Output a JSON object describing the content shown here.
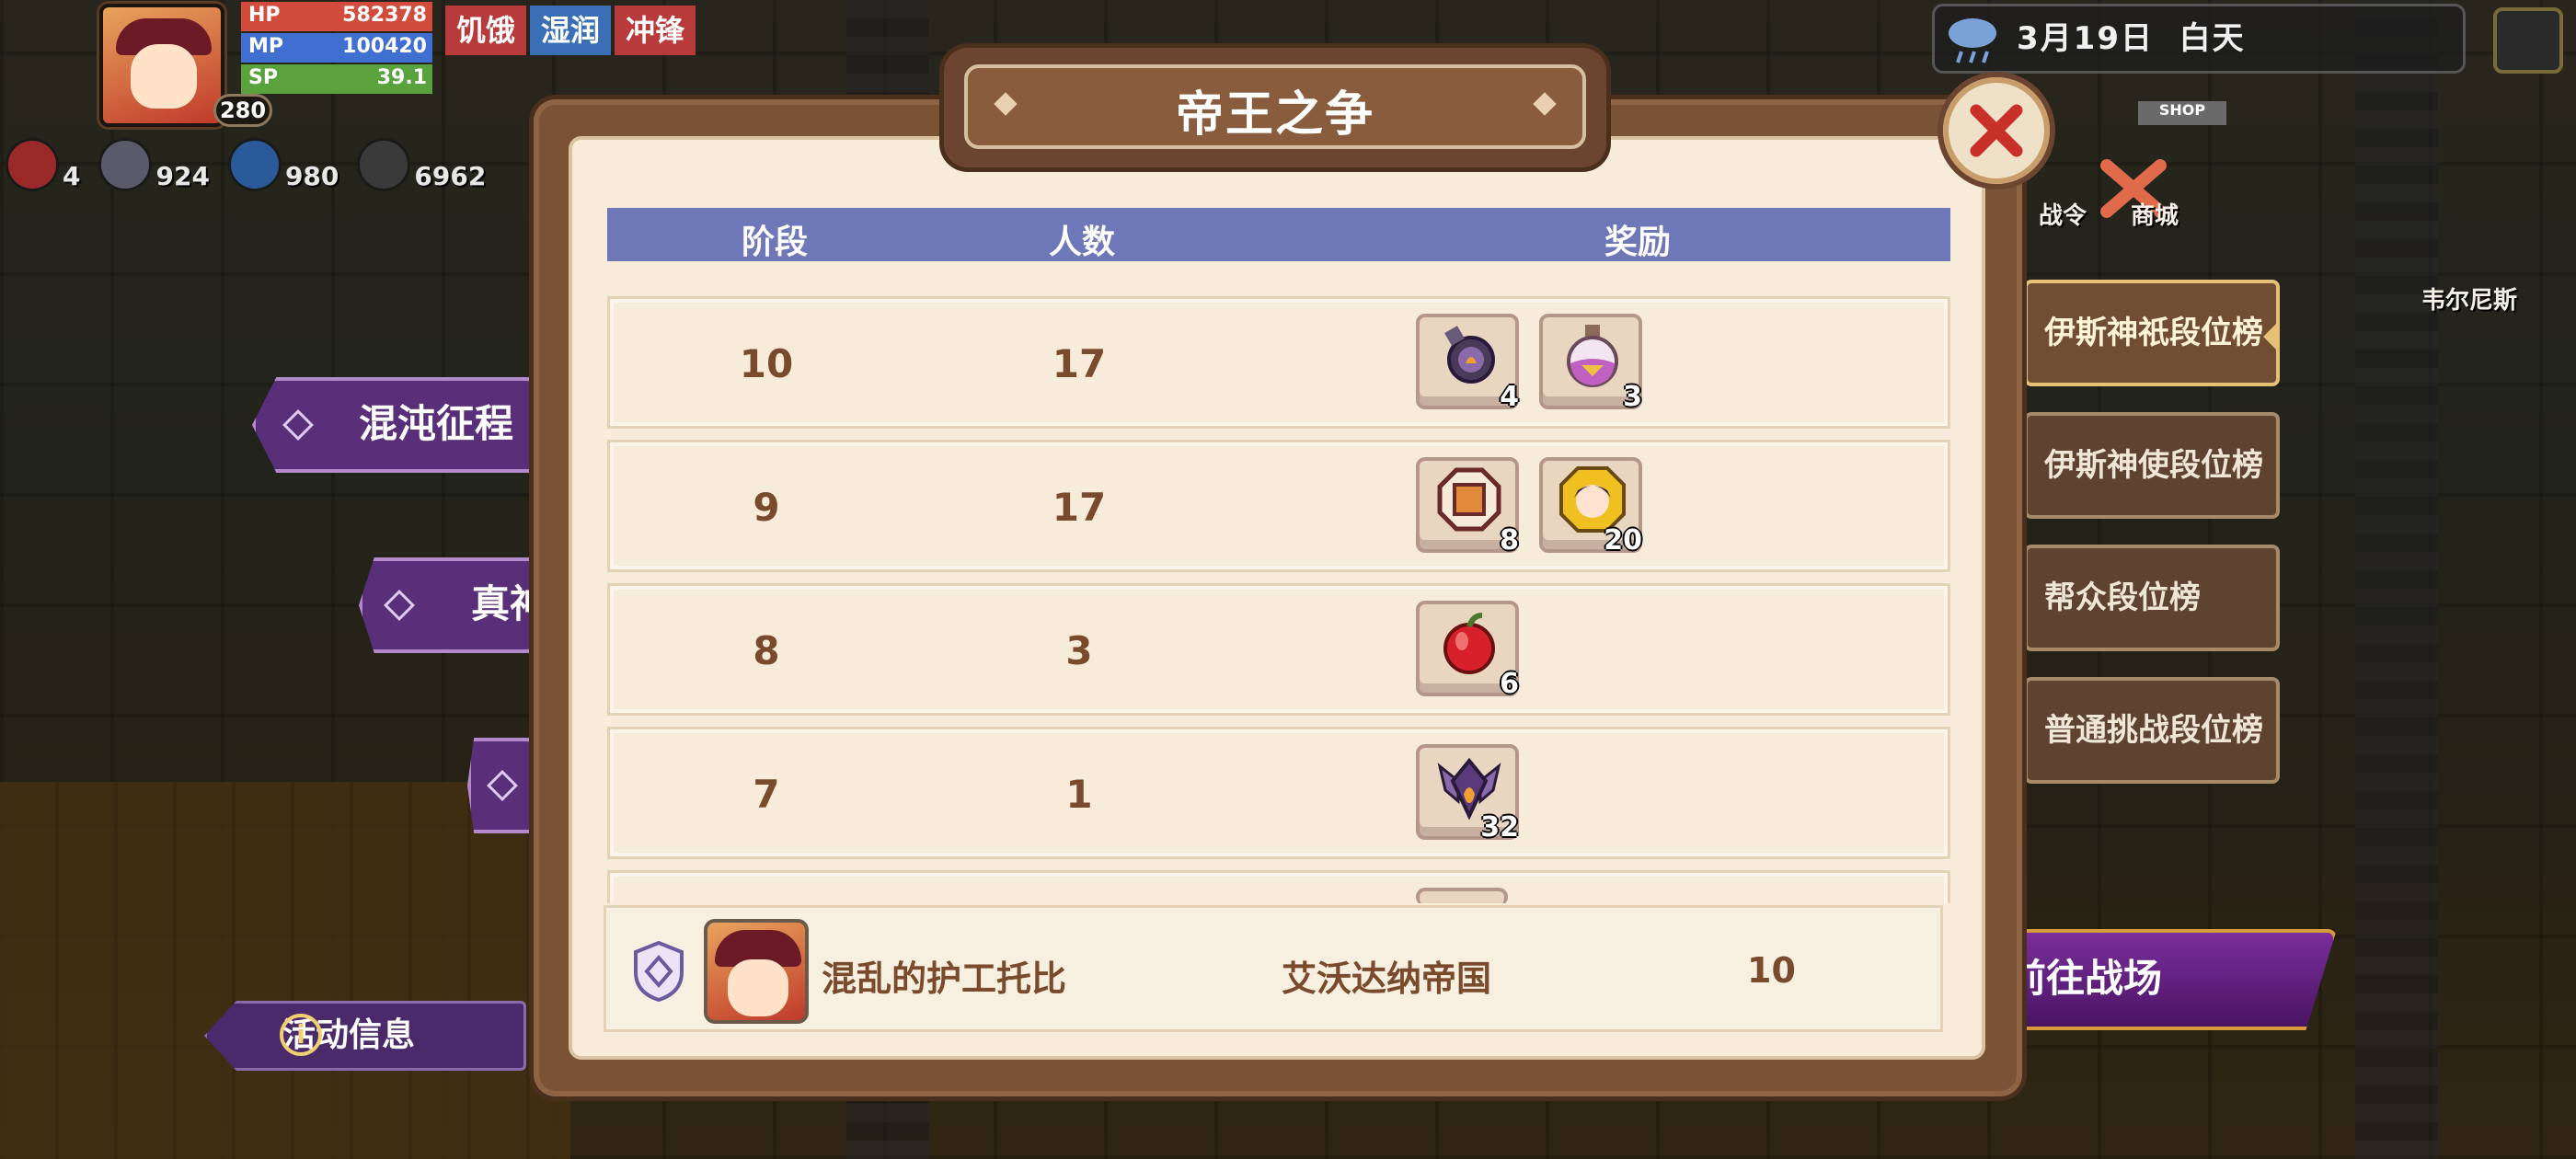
{
  "hud": {
    "level": "280",
    "stats": [
      {
        "label": "HP",
        "value": "582378",
        "color": "#d24b3c"
      },
      {
        "label": "MP",
        "value": "100420",
        "color": "#3f6fd1"
      },
      {
        "label": "SP",
        "value": "39.1",
        "color": "#5aa23c"
      }
    ],
    "status_tags": [
      {
        "label": "饥饿",
        "color": "#b83a3a"
      },
      {
        "label": "湿润",
        "color": "#3a6fb8"
      },
      {
        "label": "冲锋",
        "color": "#b83a3a"
      }
    ],
    "resources": [
      {
        "icon": "meat-icon",
        "value": "4"
      },
      {
        "icon": "gem-icon",
        "value": "924"
      },
      {
        "icon": "water-drop-icon",
        "value": "980"
      },
      {
        "icon": "blade-icon",
        "value": "6962"
      }
    ]
  },
  "top_right": {
    "date": "3月19日",
    "time_of_day": "白天",
    "shop_sign": "SHOP",
    "labels": {
      "battle_pass": "战令",
      "shop": "商城",
      "location": "韦尔尼斯"
    }
  },
  "right_tabs": [
    {
      "label": "伊斯神祇段位榜",
      "active": true
    },
    {
      "label": "伊斯神使段位榜",
      "active": false
    },
    {
      "label": "帮众段位榜",
      "active": false
    },
    {
      "label": "普通挑战段位榜",
      "active": false
    }
  ],
  "goto_button": "前往战场",
  "left_banners": [
    {
      "label": "混沌征程"
    },
    {
      "label": "真神"
    },
    {
      "label": ""
    }
  ],
  "activity_button": "活动信息",
  "modal": {
    "title": "帝王之争",
    "columns": {
      "stage": "阶段",
      "count": "人数",
      "reward": "奖励"
    },
    "rows": [
      {
        "stage": "10",
        "count": "17",
        "rewards": [
          {
            "icon": "bomb-orb-icon",
            "qty": "4"
          },
          {
            "icon": "potion-flask-icon",
            "qty": "3"
          }
        ]
      },
      {
        "stage": "9",
        "count": "17",
        "rewards": [
          {
            "icon": "octagon-token-icon",
            "qty": "8"
          },
          {
            "icon": "hero-portrait-icon",
            "qty": "20"
          }
        ]
      },
      {
        "stage": "8",
        "count": "3",
        "rewards": [
          {
            "icon": "red-apple-icon",
            "qty": "6"
          }
        ]
      },
      {
        "stage": "7",
        "count": "1",
        "rewards": [
          {
            "icon": "winged-emblem-icon",
            "qty": "32"
          }
        ]
      }
    ],
    "my_rank": {
      "player_name": "混乱的护工托比",
      "kingdom": "艾沃达纳帝国",
      "stage": "10"
    }
  }
}
